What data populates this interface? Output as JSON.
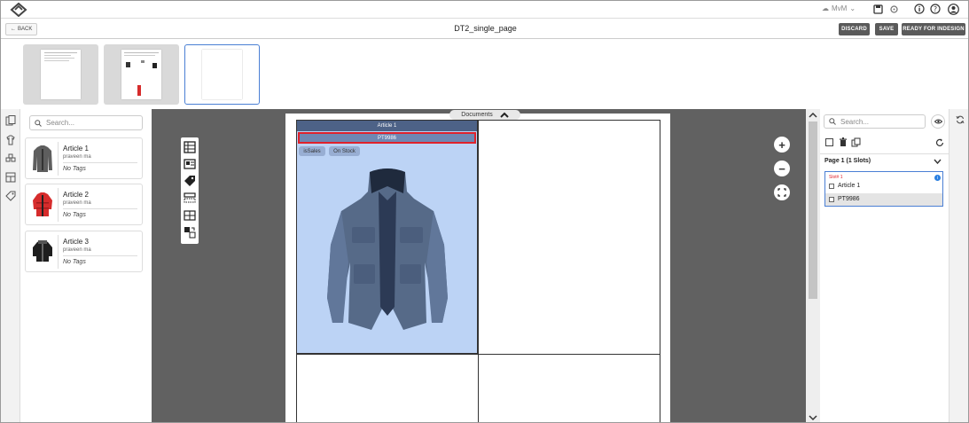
{
  "header": {
    "user_name": "MvM",
    "back_label": "BACK",
    "title": "DT2_single_page",
    "discard_label": "DISCARD",
    "save_label": "SAVE",
    "ready_label": "READY FOR INDESIGN"
  },
  "left_panel": {
    "search_placeholder": "Search...",
    "articles": [
      {
        "name": "Article 1",
        "owner": "praveen ma",
        "tags": "No Tags",
        "color": "#5e5e5e"
      },
      {
        "name": "Article 2",
        "owner": "praveen ma",
        "tags": "No Tags",
        "color": "#d62c2c"
      },
      {
        "name": "Article 3",
        "owner": "praveen ma",
        "tags": "No Tags",
        "color": "#1e1e1e"
      }
    ]
  },
  "canvas": {
    "documents_tab": "Documents",
    "slot_title": "Article 1",
    "slot_id": "PT9986",
    "chips": [
      "isSales",
      "On Stock"
    ]
  },
  "right_panel": {
    "search_placeholder": "Search...",
    "page_slots": "Page 1 (1 Slots)",
    "slot_label": "Slot# 1",
    "slot_rows": [
      "Article 1",
      "PT9986"
    ]
  },
  "colors": {
    "accent": "#4a7fd4",
    "highlight": "#e0212b",
    "slot_fill": "#bcd3f5",
    "canvas_bg": "#616161"
  }
}
